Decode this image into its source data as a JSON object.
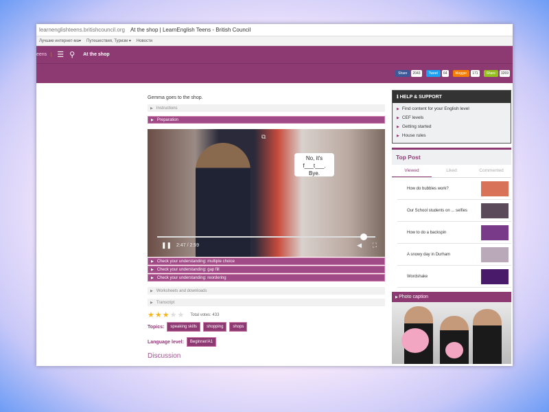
{
  "browser": {
    "url": "learnenglishteens.britishcouncil.org",
    "title": "At the shop | LearnEnglish Teens - British Council",
    "bookmarks": [
      "Лучшие интернет-ма▾",
      "Путешествия, Туризм ▾",
      "Новости"
    ]
  },
  "nav": {
    "site": "eens",
    "page_title": "At the shop"
  },
  "share": [
    {
      "label": "Share",
      "count": "2043",
      "color": "#3b5998"
    },
    {
      "label": "Tweet",
      "count": "64",
      "color": "#1da1f2"
    },
    {
      "label": "blogger",
      "count": "171",
      "color": "#f57d00"
    },
    {
      "label": "Share",
      "count": "3269",
      "color": "#95c11f"
    }
  ],
  "main": {
    "intro": "Gemma goes to the shop.",
    "instructions": "Instructions",
    "preparation": "Preparation",
    "video": {
      "caption_lines": [
        "No, it's",
        "f___t___.",
        "Bye."
      ],
      "time": "2:47 / 2:59",
      "progress": 0.93
    },
    "checks": [
      "Check your understanding: multiple choice",
      "Check your understanding: gap fill",
      "Check your understanding: reordering"
    ],
    "worksheets": "Worksheets and downloads",
    "transcript": "Transcript",
    "rating": 3,
    "votes": "Total votes: 433",
    "topics_label": "Topics:",
    "topics": [
      "speaking skills",
      "shopping",
      "shops"
    ],
    "level_label": "Language level:",
    "level": "Beginner/A1",
    "discussion": "Discussion"
  },
  "sidebar": {
    "help_title": "HELP & SUPPORT",
    "help_items": [
      "Find content for your English level",
      "CEF levels",
      "Getting started",
      "House rules"
    ],
    "top_title": "Top Post",
    "tabs": [
      "Viewed",
      "Liked",
      "Commented"
    ],
    "posts": [
      {
        "title": "How do bubbles work?",
        "thumb": "#d8735a"
      },
      {
        "title": "Our School students on ... selfies",
        "thumb": "#5a4a5a"
      },
      {
        "title": "How to do a backspin",
        "thumb": "#7a3a8a"
      },
      {
        "title": "A snowy day in Durham",
        "thumb": "#b9a9b9"
      },
      {
        "title": "Wordshake",
        "thumb": "#4a1a6a"
      }
    ],
    "photo_caption": "Photo caption"
  }
}
